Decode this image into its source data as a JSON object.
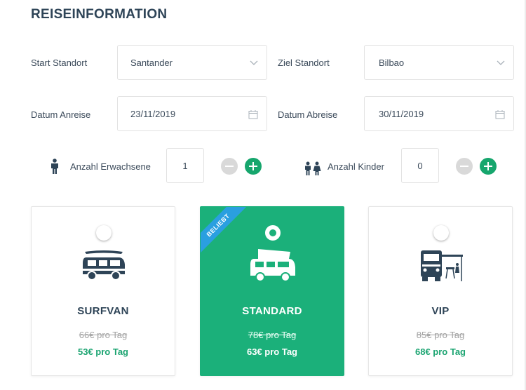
{
  "section_title": "REISEINFORMATION",
  "start": {
    "label": "Start Standort",
    "value": "Santander"
  },
  "ziel": {
    "label": "Ziel Standort",
    "value": "Bilbao"
  },
  "anreise": {
    "label": "Datum Anreise",
    "value": "23/11/2019"
  },
  "abreise": {
    "label": "Datum Abreise",
    "value": "30/11/2019"
  },
  "erwachsene": {
    "label": "Anzahl Erwachsene",
    "value": "1"
  },
  "kinder": {
    "label": "Anzahl Kinder",
    "value": "0"
  },
  "colors": {
    "accent": "#1bb07a",
    "price_green": "#1ba471",
    "ribbon": "#2a9fe0",
    "minus_gray": "#d9d9d9"
  },
  "cards": [
    {
      "name": "SURFVAN",
      "old_price": "66€ pro Tag",
      "new_price": "53€ pro Tag",
      "selected": false,
      "icon": "surfvan-icon"
    },
    {
      "name": "STANDARD",
      "old_price": "78€ pro Tag",
      "new_price": "63€ pro Tag",
      "selected": true,
      "icon": "camper-van-icon",
      "badge": "BELIEBT"
    },
    {
      "name": "VIP",
      "old_price": "85€ pro Tag",
      "new_price": "68€ pro Tag",
      "selected": false,
      "icon": "vip-van-icon"
    }
  ]
}
